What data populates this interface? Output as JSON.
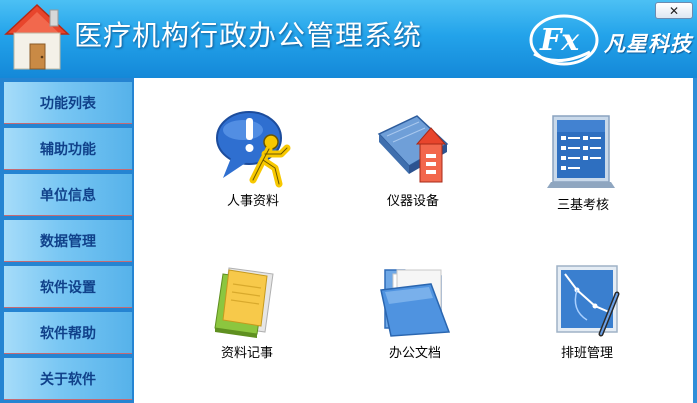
{
  "app": {
    "title": "医疗机构行政办公管理系统",
    "brand": "凡星科技",
    "logo_text": "Fx",
    "close_glyph": "✕"
  },
  "sidebar": {
    "items": [
      {
        "label": "功能列表"
      },
      {
        "label": "辅助功能"
      },
      {
        "label": "单位信息"
      },
      {
        "label": "数据管理"
      },
      {
        "label": "软件设置"
      },
      {
        "label": "软件帮助"
      },
      {
        "label": "关于软件"
      }
    ]
  },
  "tiles": [
    {
      "label": "人事资料",
      "icon": "person-chat-icon"
    },
    {
      "label": "仪器设备",
      "icon": "device-house-icon"
    },
    {
      "label": "三基考核",
      "icon": "checklist-board-icon"
    },
    {
      "label": "资料记事",
      "icon": "notebook-icon"
    },
    {
      "label": "办公文档",
      "icon": "folder-icon"
    },
    {
      "label": "排班管理",
      "icon": "chart-pen-icon"
    }
  ],
  "colors": {
    "header": "#23a3ea",
    "sidebar_bg": "#2584d2",
    "sidebar_text": "#10418a",
    "separator": "#c46a74"
  }
}
